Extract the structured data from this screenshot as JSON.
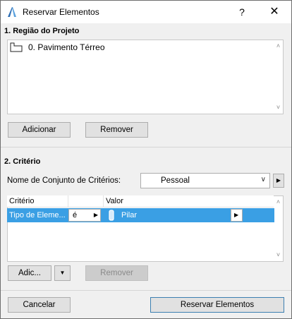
{
  "window": {
    "title": "Reservar Elementos",
    "help_label": "?",
    "close_label": "✕"
  },
  "section1": {
    "label": "1. Região do Projeto",
    "items": [
      {
        "label": "0. Pavimento Térreo",
        "icon": "story-icon"
      }
    ],
    "add_label": "Adicionar",
    "remove_label": "Remover"
  },
  "section2": {
    "label": "2. Critério",
    "set_label": "Nome de Conjunto de Critérios:",
    "set_value": "Pessoal",
    "columns": {
      "criterion": "Critério",
      "value": "Valor"
    },
    "rows": [
      {
        "criterion": "Tipo de Eleme...",
        "operator": "é",
        "value": "Pilar",
        "value_icon": "column-icon"
      }
    ],
    "add_label": "Adic...",
    "remove_label": "Remover"
  },
  "footer": {
    "cancel_label": "Cancelar",
    "reserve_label": "Reservar Elementos"
  },
  "colors": {
    "selection": "#3a9fe4",
    "default_button_border": "#3c7fb1"
  }
}
